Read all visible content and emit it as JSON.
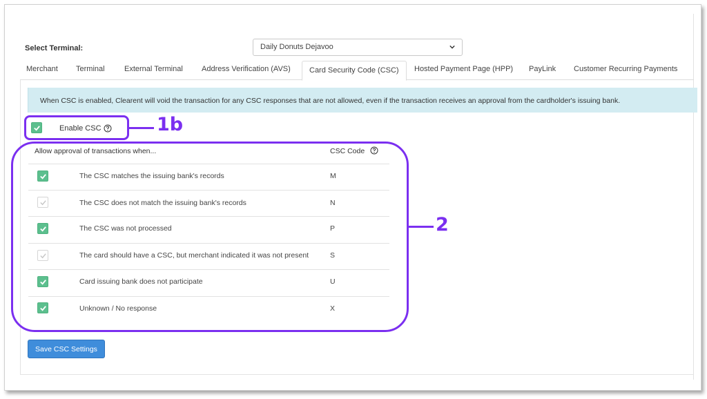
{
  "terminal": {
    "label": "Select Terminal:",
    "selected": "Daily Donuts Dejavoo"
  },
  "tabs": [
    {
      "label": "Merchant"
    },
    {
      "label": "Terminal"
    },
    {
      "label": "External Terminal"
    },
    {
      "label": "Address Verification (AVS)"
    },
    {
      "label": "Card Security Code (CSC)"
    },
    {
      "label": "Hosted Payment Page (HPP)"
    },
    {
      "label": "PayLink"
    },
    {
      "label": "Customer Recurring Payments"
    }
  ],
  "active_tab": "Card Security Code (CSC)",
  "banner": "When CSC is enabled, Clearent will void the transaction for any CSC responses that are not allowed, even if the transaction receives an approval from the cardholder's issuing bank.",
  "enable_csc": {
    "label": "Enable CSC",
    "checked": true
  },
  "table": {
    "header_left": "Allow approval of transactions when...",
    "header_right": "CSC Code",
    "rows": [
      {
        "text": "The CSC matches the issuing bank's records",
        "code": "M",
        "checked": true
      },
      {
        "text": "The CSC does not match the issuing bank's records",
        "code": "N",
        "checked": false
      },
      {
        "text": "The CSC was not processed",
        "code": "P",
        "checked": true
      },
      {
        "text": "The card should have a CSC, but merchant indicated it was not present",
        "code": "S",
        "checked": false
      },
      {
        "text": "Card issuing bank does not participate",
        "code": "U",
        "checked": true
      },
      {
        "text": "Unknown / No response",
        "code": "X",
        "checked": true
      }
    ]
  },
  "save_button": "Save CSC Settings",
  "annotations": {
    "a": "1b",
    "b": "2"
  },
  "colors": {
    "accent": "#7b2ff0",
    "check_green": "#5cbf8e",
    "button_blue": "#3f8ddb",
    "banner": "#d3ecf2"
  },
  "icons": [
    "chevron-down-icon",
    "help-circle-icon",
    "checkmark-icon"
  ]
}
